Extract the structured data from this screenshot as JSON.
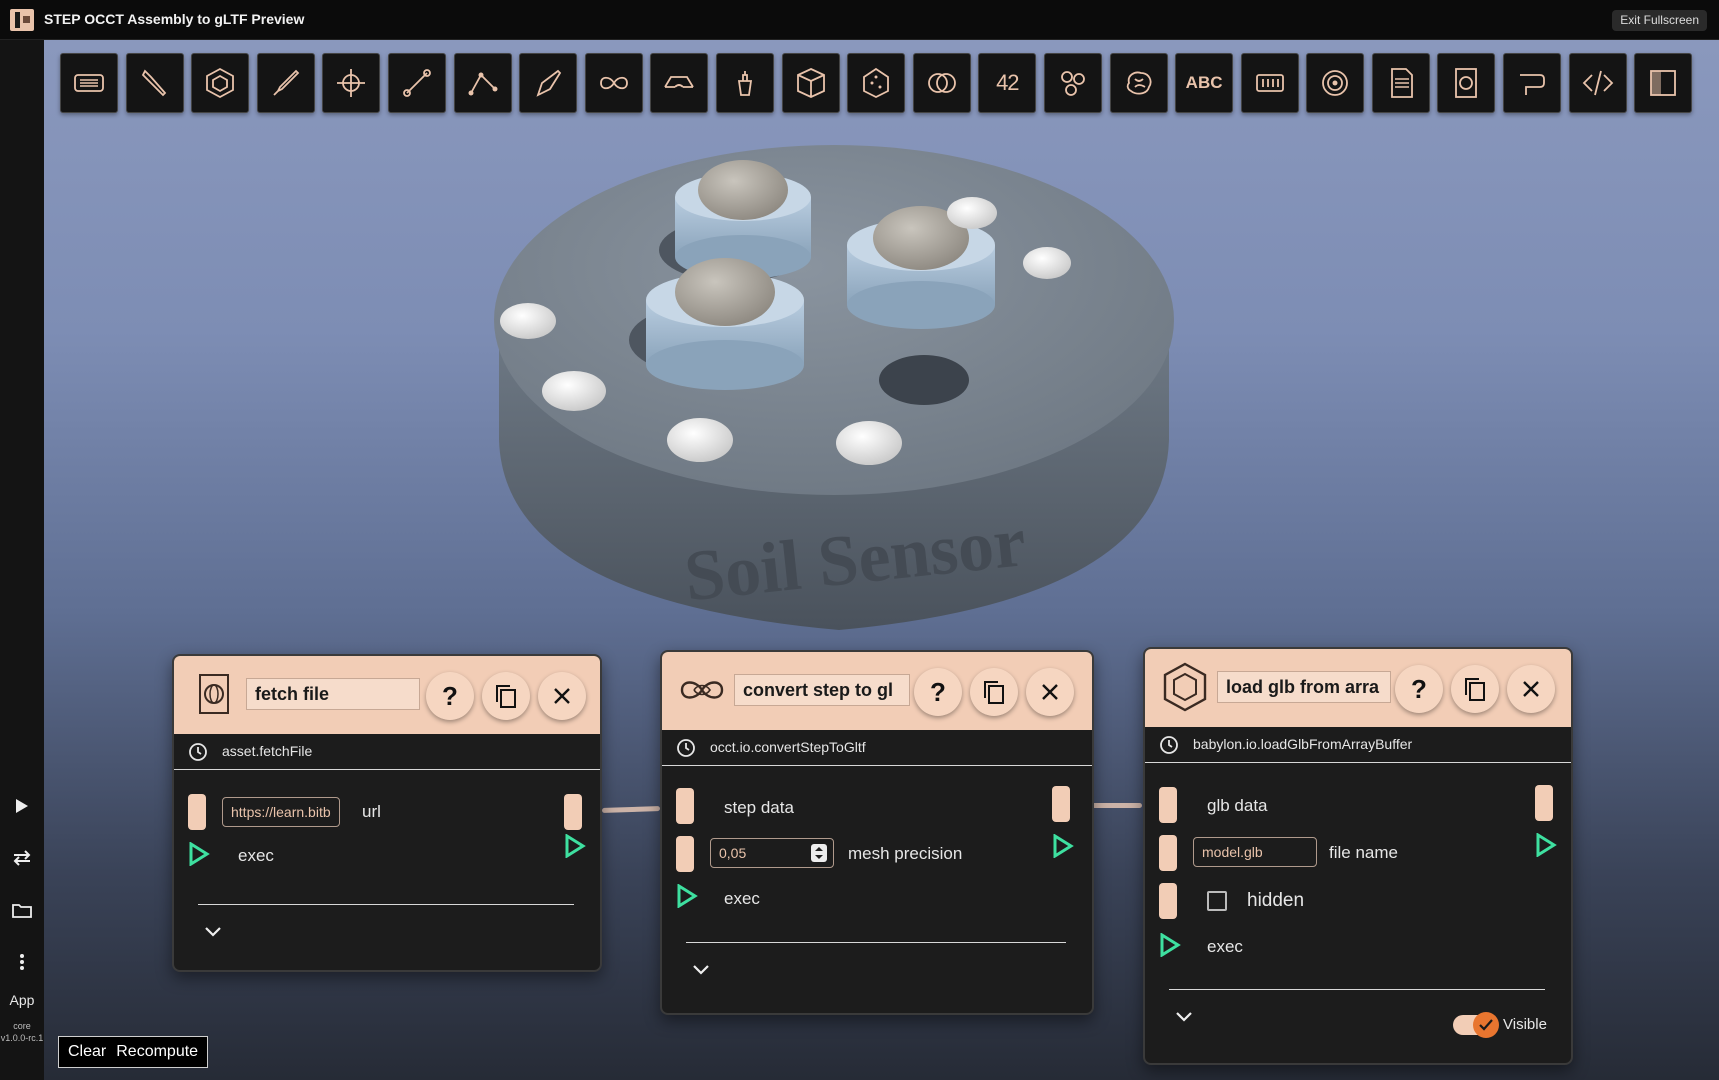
{
  "app": {
    "title": "STEP OCCT Assembly to gLTF Preview",
    "exit_label": "Exit Fullscreen",
    "sidebar_app_label": "App",
    "version": "core v1.0.0-rc.1"
  },
  "toolbar": {
    "tools": [
      "menu",
      "wrench",
      "hexagon",
      "brush",
      "crosshair",
      "line",
      "polyline",
      "pen",
      "infinity",
      "glasses",
      "potion",
      "cube",
      "dice",
      "rings",
      "42",
      "molecule",
      "brain",
      "ABC",
      "grid",
      "spiral",
      "csv",
      "asset",
      "route",
      "code",
      "panel"
    ]
  },
  "scene": {
    "model_text": "Soil Sensor"
  },
  "nodes": {
    "fetch": {
      "name": "fetch file",
      "function": "asset.fetchFile",
      "url_value": "https://learn.bitb",
      "url_label": "url",
      "exec_label": "exec"
    },
    "convert": {
      "name": "convert step to gl",
      "function": "occt.io.convertStepToGltf",
      "step_label": "step data",
      "precision_value": "0,05",
      "precision_label": "mesh precision",
      "exec_label": "exec"
    },
    "load": {
      "name": "load glb from arra",
      "function": "babylon.io.loadGlbFromArrayBuffer",
      "glb_label": "glb data",
      "file_value": "model.glb",
      "file_label": "file name",
      "hidden_label": "hidden",
      "exec_label": "exec",
      "visible_label": "Visible",
      "visible_on": true
    }
  },
  "bottom": {
    "clear_label": "Clear",
    "recompute_label": "Recompute"
  },
  "colors": {
    "accent": "#f2cdb6",
    "exec_green": "#3ee0a0",
    "toggle_on": "#e8752f"
  }
}
